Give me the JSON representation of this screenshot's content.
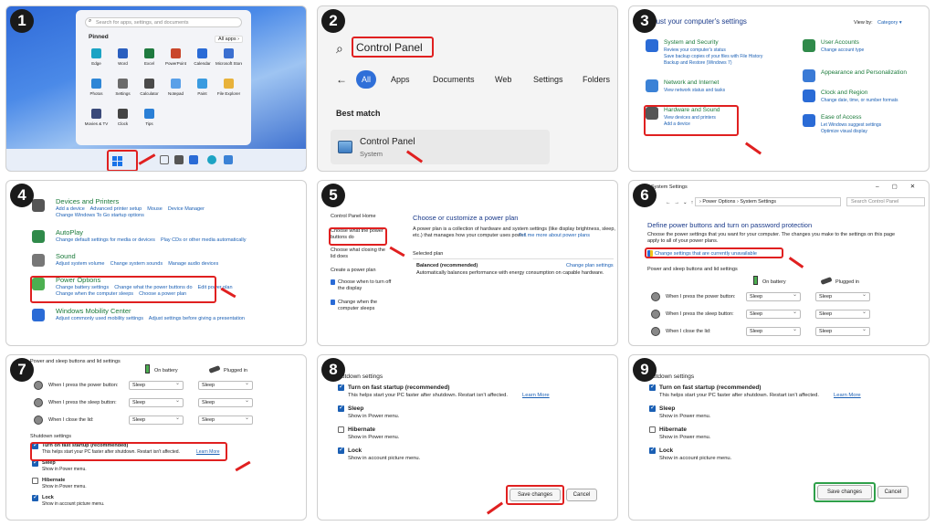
{
  "steps": [
    "1",
    "2",
    "3",
    "4",
    "5",
    "6",
    "7",
    "8",
    "9"
  ],
  "p1": {
    "search_placeholder": "Search for apps, settings, and documents",
    "pinned": "Pinned",
    "all_apps": "All apps ›",
    "apps": [
      "Edge",
      "Word",
      "Excel",
      "PowerPoint",
      "Calendar",
      "Microsoft Store",
      "Photos",
      "Settings",
      "Calculator",
      "Notepad",
      "Paint",
      "File Explorer",
      "Movies & TV",
      "Clock",
      "Tips"
    ]
  },
  "p2": {
    "search_value": "Control Panel",
    "tabs": [
      "All",
      "Apps",
      "Documents",
      "Web",
      "Settings",
      "Folders"
    ],
    "best_match": "Best match",
    "result_title": "Control Panel",
    "result_sub": "System"
  },
  "p3": {
    "title": "Adjust your computer's settings",
    "view_by": "View by:",
    "view_value": "Category ▾",
    "left": [
      {
        "title": "System and Security",
        "links": [
          "Review your computer's status",
          "Save backup copies of your files with File History",
          "Backup and Restore (Windows 7)"
        ]
      },
      {
        "title": "Network and Internet",
        "links": [
          "View network status and tasks"
        ]
      },
      {
        "title": "Hardware and Sound",
        "links": [
          "View devices and printers",
          "Add a device"
        ]
      }
    ],
    "right": [
      {
        "title": "User Accounts",
        "links": [
          "Change account type"
        ]
      },
      {
        "title": "Appearance and Personalization",
        "links": []
      },
      {
        "title": "Clock and Region",
        "links": [
          "Change date, time, or number formats"
        ]
      },
      {
        "title": "Ease of Access",
        "links": [
          "Let Windows suggest settings",
          "Optimize visual display"
        ]
      }
    ]
  },
  "p4": {
    "items": [
      {
        "title": "Devices and Printers",
        "links": "Add a device    Advanced printer setup    Mouse    Device Manager",
        "links2": "Change Windows To Go startup options"
      },
      {
        "title": "AutoPlay",
        "links": "Change default settings for media or devices    Play CDs or other media automatically",
        "links2": ""
      },
      {
        "title": "Sound",
        "links": "Adjust system volume    Change system sounds    Manage audio devices",
        "links2": ""
      },
      {
        "title": "Power Options",
        "links": "Change battery settings    Change what the power buttons do    Edit power plan",
        "links2": "Change when the computer sleeps    Choose a power plan"
      },
      {
        "title": "Windows Mobility Center",
        "links": "Adjust commonly used mobility settings    Adjust settings before giving a presentation",
        "links2": ""
      }
    ]
  },
  "p5": {
    "home": "Control Panel Home",
    "side": [
      "Choose what the power buttons do",
      "Choose what closing the lid does",
      "Create a power plan",
      "Choose when to turn off the display",
      "Change when the computer sleeps"
    ],
    "heading": "Choose or customize a power plan",
    "desc1": "A power plan is a collection of hardware and system settings (like display brightness, sleep,",
    "desc2": "etc.) that manages how your computer uses power.",
    "desc_link": "Tell me more about power plans",
    "selected_plan": "Selected plan",
    "plan_name": "Balanced (recommended)",
    "plan_link": "Change plan settings",
    "plan_desc": "Automatically balances performance with energy consumption on capable hardware."
  },
  "p6": {
    "window_title": "System Settings",
    "breadcrumb": "›   Power Options  ›  System Settings",
    "search_placeholder": "Search Control Panel",
    "heading": "Define power buttons and turn on password protection",
    "desc": "Choose the power settings that you want for your computer. The changes you make to the settings on this page apply to all of your power plans.",
    "unavail_link": "Change settings that are currently unavailable",
    "section": "Power and sleep buttons and lid settings",
    "on_battery": "On battery",
    "plugged_in": "Plugged in",
    "rows": [
      "When I press the power button:",
      "When I press the sleep button:",
      "When I close the lid:"
    ],
    "value": "Sleep"
  },
  "p7": {
    "section": "Power and sleep buttons and lid settings",
    "on_battery": "On battery",
    "plugged_in": "Plugged in",
    "rows": [
      "When I press the power button:",
      "When I press the sleep button:",
      "When I close the lid:"
    ],
    "value": "Sleep",
    "shutdown": "Shutdown settings",
    "opts": [
      {
        "title": "Turn on fast startup (recommended)",
        "desc": "This helps start your PC faster after shutdown. Restart isn't affected.",
        "link": "Learn More",
        "checked": true
      },
      {
        "title": "Sleep",
        "desc": "Show in Power menu.",
        "link": "",
        "checked": true
      },
      {
        "title": "Hibernate",
        "desc": "Show in Power menu.",
        "link": "",
        "checked": false
      },
      {
        "title": "Lock",
        "desc": "Show in account picture menu.",
        "link": "",
        "checked": true
      }
    ]
  },
  "p8": {
    "shutdown": "Shutdown settings",
    "opts": [
      {
        "title": "Turn on fast startup (recommended)",
        "desc": "This helps start your PC faster after shutdown. Restart isn't affected.",
        "link": "Learn More"
      },
      {
        "title": "Sleep",
        "desc": "Show in Power menu.",
        "link": ""
      },
      {
        "title": "Hibernate",
        "desc": "Show in Power menu.",
        "link": ""
      },
      {
        "title": "Lock",
        "desc": "Show in account picture menu.",
        "link": ""
      }
    ],
    "save": "Save changes",
    "cancel": "Cancel"
  },
  "p9": {
    "shutdown": "Shutdown settings",
    "opts": [
      {
        "title": "Turn on fast startup (recommended)",
        "desc": "This helps start your PC faster after shutdown. Restart isn't affected.",
        "link": "Learn More"
      },
      {
        "title": "Sleep",
        "desc": "Show in Power menu.",
        "link": ""
      },
      {
        "title": "Hibernate",
        "desc": "Show in Power menu.",
        "link": ""
      },
      {
        "title": "Lock",
        "desc": "Show in account picture menu.",
        "link": ""
      }
    ],
    "save": "Save changes",
    "cancel": "Cancel"
  }
}
